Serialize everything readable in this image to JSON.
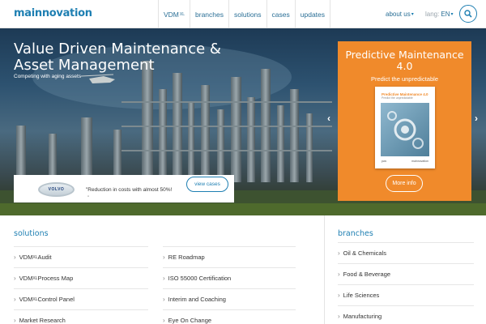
{
  "header": {
    "logo": "mainnovation",
    "nav": [
      {
        "label": "VDM",
        "sup": "XL"
      },
      {
        "label": "branches",
        "sup": ""
      },
      {
        "label": "solutions",
        "sup": ""
      },
      {
        "label": "cases",
        "sup": ""
      },
      {
        "label": "updates",
        "sup": ""
      }
    ],
    "about_us": "about us",
    "lang_label": "lang:",
    "lang_value": "EN",
    "search_icon": "search-icon"
  },
  "hero": {
    "title": "Value Driven Maintenance & Asset Management",
    "subtitle": "Competing with aging assets",
    "quote": "\"Reduction in costs with almost 50%!",
    "quote_dot": "\"",
    "logo_text": "VOLVO",
    "view_cases": "view cases",
    "promo": {
      "title": "Predictive Maintenance 4.0",
      "subtitle": "Predict the unpredictable",
      "book_title": "Predictive Maintenance 4.0",
      "book_subtitle": "Predict the unpredictable",
      "book_left": "pwc",
      "book_right": "mainnovation",
      "more_info": "More info"
    },
    "colors": {
      "promo": "#f08a2b",
      "brand": "#1e7fb2"
    }
  },
  "solutions": {
    "title": "solutions",
    "col1": [
      {
        "label": "VDM",
        "sup": "XL",
        "after": " Audit"
      },
      {
        "label": "VDM",
        "sup": "XL",
        "after": " Process Map"
      },
      {
        "label": "VDM",
        "sup": "XL",
        "after": " Control Panel"
      },
      {
        "label": "Market Research",
        "sup": "",
        "after": ""
      }
    ],
    "col2": [
      {
        "label": "RE Roadmap"
      },
      {
        "label": "ISO 55000 Certification"
      },
      {
        "label": "Interim and Coaching"
      },
      {
        "label": "Eye On Change"
      }
    ]
  },
  "branches": {
    "title": "branches",
    "items": [
      {
        "label": "Oil & Chemicals"
      },
      {
        "label": "Food & Beverage"
      },
      {
        "label": "Life Sciences"
      },
      {
        "label": "Manufacturing"
      }
    ]
  }
}
